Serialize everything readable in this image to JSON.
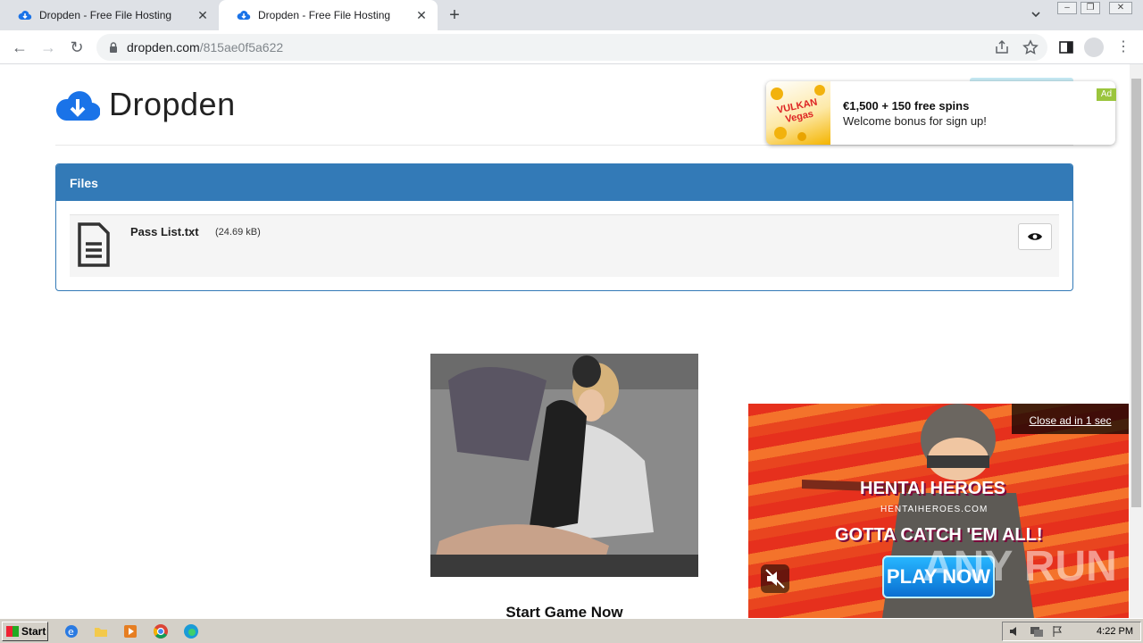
{
  "browser": {
    "tabs": [
      {
        "title": "Dropden - Free File Hosting",
        "close": "✕"
      },
      {
        "title": "Dropden - Free File Hosting",
        "close": "✕"
      }
    ],
    "new_tab": "+",
    "url_host": "dropden.com",
    "url_path": "/815ae0f5a622"
  },
  "site": {
    "brand": "Dropden",
    "files_heading": "Files",
    "file": {
      "name": "Pass List.txt",
      "size": "(24.69 kB)"
    }
  },
  "ads": {
    "top": {
      "brand": "VULKAN Vegas",
      "line1": "€1,500 + 150 free spins",
      "line2": "Welcome bonus for sign up!",
      "tag": "Ad"
    },
    "game_cta": "Start Game Now",
    "video": {
      "close": "Close ad in 1 sec",
      "title": "HENTAI HEROES",
      "url": "HENTAIHEROES.COM",
      "tagline": "GOTTA CATCH 'EM ALL!",
      "button": "PLAY NOW"
    }
  },
  "watermark": "ANY RUN",
  "taskbar": {
    "start": "Start",
    "clock": "4:22 PM"
  }
}
